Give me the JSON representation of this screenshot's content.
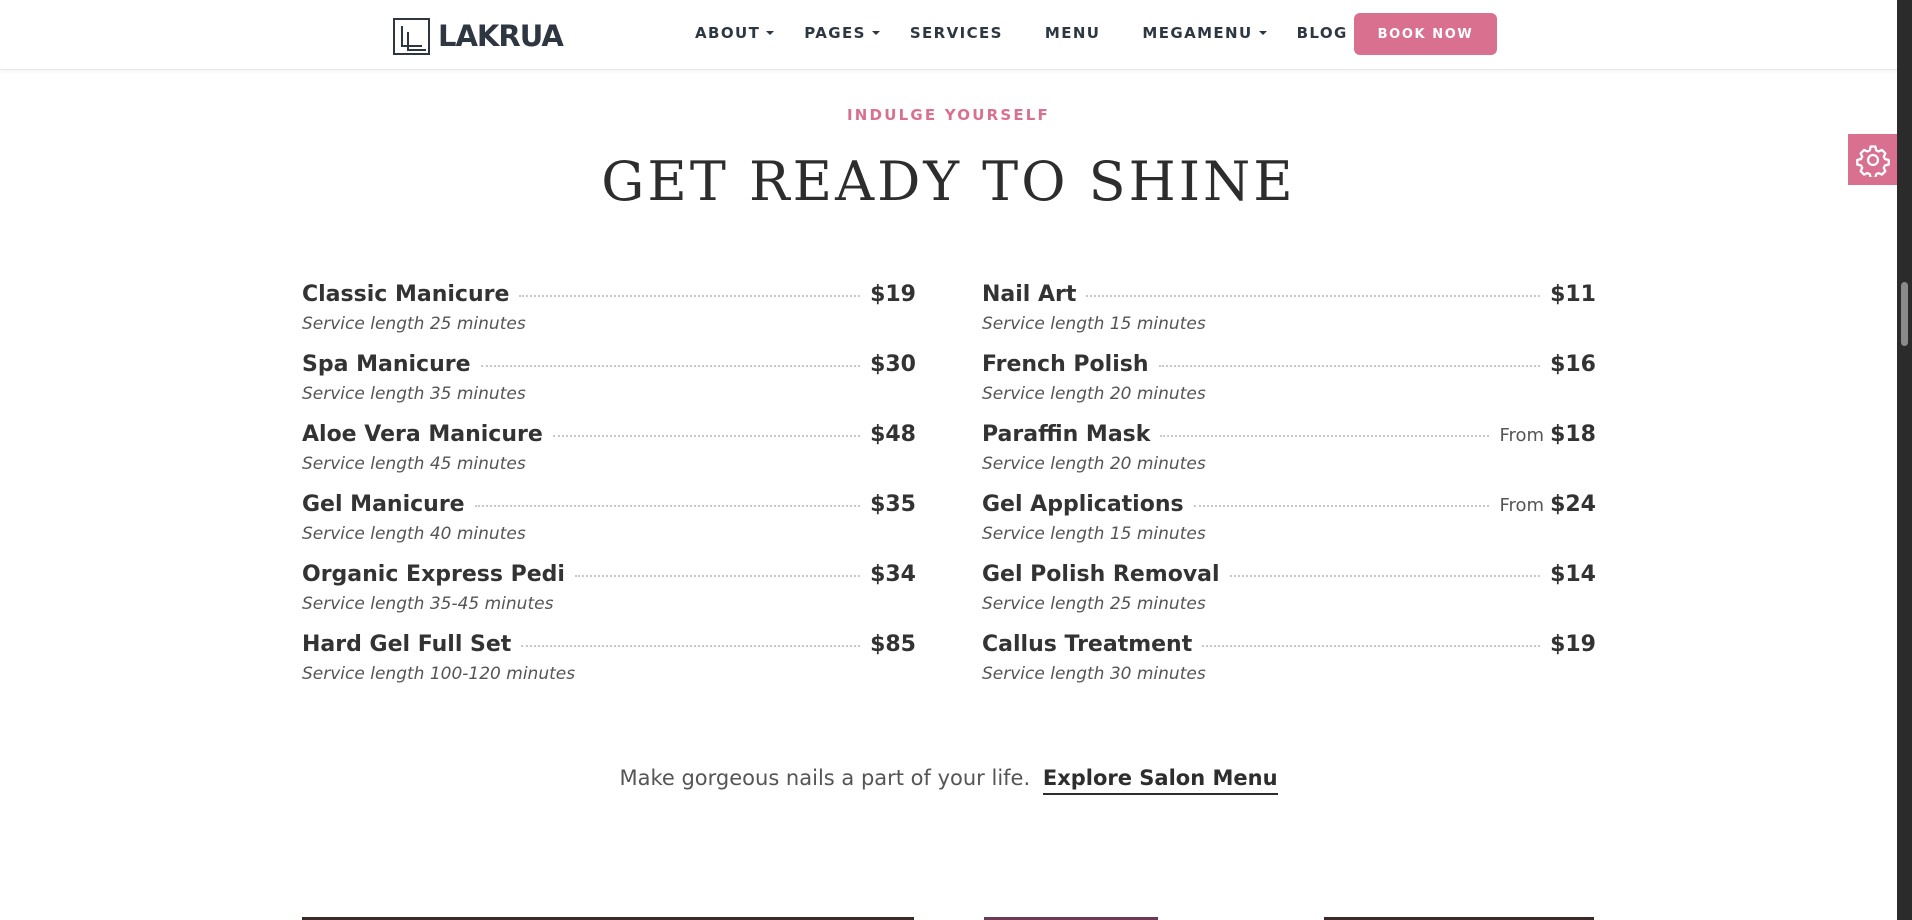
{
  "header": {
    "logo_text": "LAKRUA",
    "nav": [
      {
        "label": "ABOUT",
        "has_caret": true
      },
      {
        "label": "PAGES",
        "has_caret": true
      },
      {
        "label": "SERVICES",
        "has_caret": false
      },
      {
        "label": "MENU",
        "has_caret": false
      },
      {
        "label": "MEGAMENU",
        "has_caret": true
      },
      {
        "label": "BLOG",
        "has_caret": false
      }
    ],
    "book_button": "BOOK NOW"
  },
  "section": {
    "eyebrow": "INDULGE YOURSELF",
    "title": "GET READY TO SHINE"
  },
  "services_left": [
    {
      "name": "Classic Manicure",
      "from": "",
      "price": "$19",
      "length": "Service length 25 minutes"
    },
    {
      "name": "Spa Manicure",
      "from": "",
      "price": "$30",
      "length": "Service length 35 minutes"
    },
    {
      "name": "Aloe Vera Manicure",
      "from": "",
      "price": "$48",
      "length": "Service length 45 minutes"
    },
    {
      "name": "Gel Manicure",
      "from": "",
      "price": "$35",
      "length": "Service length 40 minutes"
    },
    {
      "name": "Organic Express Pedi",
      "from": "",
      "price": "$34",
      "length": "Service length 35-45 minutes"
    },
    {
      "name": "Hard Gel Full Set",
      "from": "",
      "price": "$85",
      "length": "Service length 100-120 minutes"
    }
  ],
  "services_right": [
    {
      "name": "Nail Art",
      "from": "",
      "price": "$11",
      "length": "Service length 15 minutes"
    },
    {
      "name": "French Polish",
      "from": "",
      "price": "$16",
      "length": "Service length 20 minutes"
    },
    {
      "name": "Paraffin Mask",
      "from": "From",
      "price": "$18",
      "length": "Service length 20 minutes"
    },
    {
      "name": "Gel Applications",
      "from": "From",
      "price": "$24",
      "length": "Service length 15 minutes"
    },
    {
      "name": "Gel Polish Removal",
      "from": "",
      "price": "$14",
      "length": "Service length 25 minutes"
    },
    {
      "name": "Callus Treatment",
      "from": "",
      "price": "$19",
      "length": "Service length 30 minutes"
    }
  ],
  "cta": {
    "text": "Make gorgeous nails a part of your life.",
    "link": "Explore Salon Menu"
  },
  "colors": {
    "accent": "#d9708f",
    "dark": "#2e3642"
  },
  "icons": {
    "settings": "gear-icon"
  }
}
